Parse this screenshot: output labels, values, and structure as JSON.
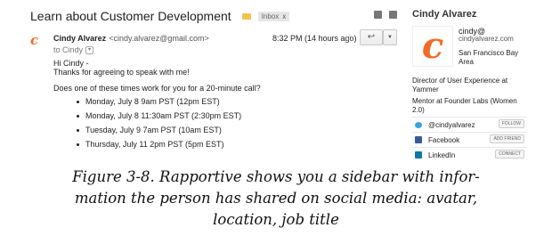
{
  "email": {
    "subject": "Learn about Customer Development",
    "label": "Inbox",
    "label_close": "x",
    "avatar_letter": "c",
    "sender_name": "Cindy Alvarez",
    "sender_email": "<cindy.alvarez@gmail.com>",
    "to_line": "to Cindy",
    "timestamp": "8:32 PM (14 hours ago)",
    "greeting": "Hi Cindy -",
    "thanks": "Thanks for agreeing to speak with me!",
    "question": "Does one of these times work for you for a 20-minute call?",
    "times": [
      "Monday, July 8 9am PST (12pm EST)",
      "Monday, July 8 11:30am PST (2:30pm EST)",
      "Tuesday, July 9 7am PST (10am EST)",
      "Thursday, July 11 2pm PST (5pm EST)"
    ]
  },
  "sidebar": {
    "name": "Cindy Alvarez",
    "avatar_letter": "c",
    "handle": "cindy@",
    "email": "cindyalvarez.com",
    "location": "San Francisco Bay Area",
    "job": "Director of User Experience at Yammer",
    "mentor": "Mentor at Founder Labs (Women 2.0)",
    "social": [
      {
        "network": "twitter",
        "label": "@cindyalvarez",
        "action": "FOLLOW"
      },
      {
        "network": "facebook",
        "label": "Facebook",
        "action": "ADD FRIEND"
      },
      {
        "network": "linkedin",
        "label": "LinkedIn",
        "action": "CONNECT"
      }
    ]
  },
  "caption": {
    "line1": "Figure 3-8. Rapportive shows you a sidebar with infor-",
    "line2": "mation the person has shared on social media: avatar,",
    "line3": "location, job title"
  },
  "colors": {
    "avatar_orange": "#f26b25",
    "label_yellow": "#f5c24b",
    "twitter": "#3ca2e0",
    "facebook": "#3b5998",
    "linkedin": "#0e76a8"
  },
  "icons": {
    "star": "☆",
    "reply": "↩",
    "more": "▼",
    "to_caret": "▾"
  }
}
